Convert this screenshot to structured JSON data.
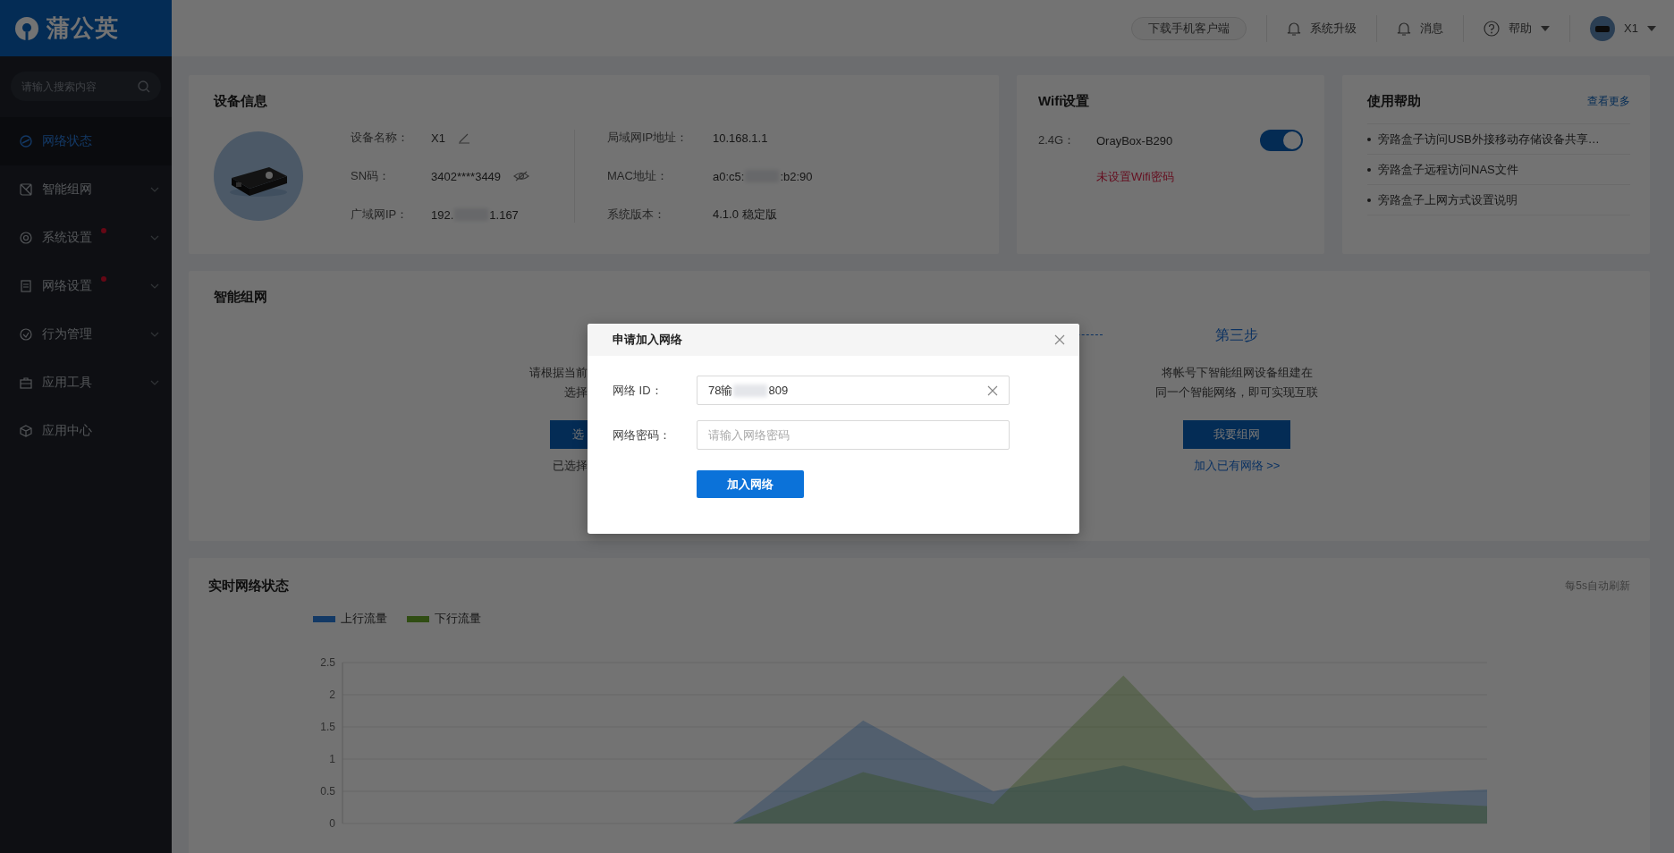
{
  "header": {
    "logo": "蒲公英",
    "download": "下载手机客户端",
    "upgrade": "系统升级",
    "messages": "消息",
    "help": "帮助",
    "user": "X1"
  },
  "sidebar": {
    "search_placeholder": "请输入搜索内容",
    "items": [
      {
        "label": "网络状态",
        "selected": true,
        "badge": false,
        "expandable": false
      },
      {
        "label": "智能组网",
        "selected": false,
        "badge": false,
        "expandable": true
      },
      {
        "label": "系统设置",
        "selected": false,
        "badge": true,
        "expandable": true
      },
      {
        "label": "网络设置",
        "selected": false,
        "badge": true,
        "expandable": true
      },
      {
        "label": "行为管理",
        "selected": false,
        "badge": false,
        "expandable": true
      },
      {
        "label": "应用工具",
        "selected": false,
        "badge": false,
        "expandable": true
      },
      {
        "label": "应用中心",
        "selected": false,
        "badge": false,
        "expandable": false
      }
    ]
  },
  "device_info": {
    "title": "设备信息",
    "left_fields": [
      {
        "label": "设备名称：",
        "value_parts": [
          "X1"
        ],
        "kind": "editable"
      },
      {
        "label": "SN码：",
        "value_parts": [
          "3402****3449"
        ],
        "kind": "masked"
      },
      {
        "label": "广域网IP：",
        "value_parts": [
          "192.",
          "1.167"
        ]
      }
    ],
    "right_fields": [
      {
        "label": "局域网IP地址：",
        "value_parts": [
          "10.168.1.1"
        ]
      },
      {
        "label": "MAC地址：",
        "value_parts": [
          "a0:c5:",
          ":b2:90"
        ]
      },
      {
        "label": "系统版本：",
        "value_parts": [
          "4.1.0 稳定版"
        ]
      }
    ]
  },
  "wifi": {
    "title": "Wifi设置",
    "band": "2.4G：",
    "ssid": "OrayBox-B290",
    "on": true,
    "warning": "未设置Wifi密码"
  },
  "help": {
    "title": "使用帮助",
    "more": "查看更多",
    "links": [
      "旁路盒子访问USB外接移动存储设备共享…",
      "旁路盒子远程访问NAS文件",
      "旁路盒子上网方式设置说明"
    ]
  },
  "mesh": {
    "title": "智能组网",
    "left_step": {
      "desc": [
        "请根据当前",
        "选择"
      ],
      "button": "选",
      "note": "已选择"
    },
    "right_step": {
      "title": "第三步",
      "desc": [
        "将帐号下智能组网设备组建在",
        "同一个智能网络，即可实现互联"
      ],
      "button": "我要组网",
      "note": "加入已有网络 >>"
    }
  },
  "traffic": {
    "title": "实时网络状态",
    "refresh": "每5s自动刷新",
    "chart_data": {
      "type": "area",
      "grid": true,
      "ylim": [
        0,
        2.5
      ],
      "yticks": [
        0,
        0.5,
        1,
        1.5,
        2,
        2.5
      ],
      "series": [
        {
          "name": "上行流量",
          "color": "#2a7fe0",
          "values": [
            0,
            0,
            0,
            0,
            1.6,
            0.5,
            0.9,
            0.4,
            0.45,
            0.55
          ]
        },
        {
          "name": "下行流量",
          "color": "#6aaa2a",
          "values": [
            0,
            0,
            0,
            0,
            0.8,
            0.3,
            2.3,
            0.2,
            0.35,
            0.25
          ]
        }
      ]
    }
  },
  "dialog": {
    "title": "申请加入网络",
    "fields": [
      {
        "label": "网络 ID：",
        "value_parts": [
          "78输",
          "809"
        ],
        "clearable": true
      },
      {
        "label": "网络密码：",
        "placeholder": "请输入网络密码",
        "clearable": false
      }
    ],
    "submit": "加入网络"
  }
}
